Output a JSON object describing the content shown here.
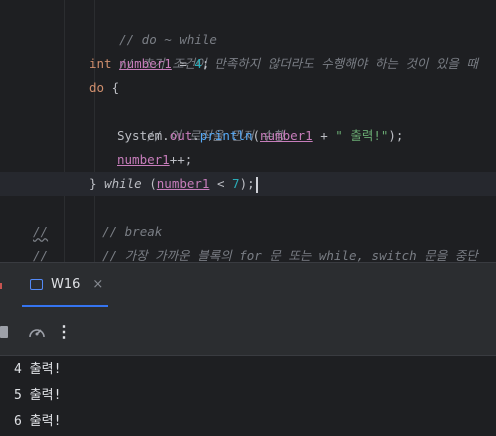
{
  "editor": {
    "lines": {
      "l1": {
        "comment": "// do ~ while"
      },
      "l2": {
        "comment": "// 초기 조건이 만족하지 않더라도 수행해야 하는 것이 있을 때"
      },
      "l3": {
        "kw": "int",
        "var": "number1",
        "op": " = ",
        "num": "4",
        "end": ";"
      },
      "l4": {
        "kw": "do",
        "brace": " {"
      },
      "l5": {
        "comment": "// 이 로직을 먼저 수행"
      },
      "l6": {
        "cls": "System",
        "dot1": ".",
        "fld": "out",
        "dot2": ".",
        "mth": "println",
        "open": "(",
        "var": "number1",
        "plus": " + ",
        "str": "\" 출력!\"",
        "close": ");"
      },
      "l7": {
        "var": "number1",
        "op": "++;"
      },
      "l8": {
        "brace": "} ",
        "kw": "while",
        "open": " (",
        "var": "number1",
        "op": " < ",
        "num": "7",
        "close": ");"
      },
      "l9": {
        "slashes": "//",
        "comment": "// break"
      },
      "l10": {
        "slashes": "//",
        "comment": "// 가장 가까운 블록의 for 문 또는 while, switch 문을 중단"
      }
    }
  },
  "panel": {
    "tab_label": "W16",
    "close_glyph": "×",
    "kebab_glyph": "⋮"
  },
  "console": {
    "lines": [
      "4 출력!",
      "5 출력!",
      "6 출력!"
    ]
  }
}
